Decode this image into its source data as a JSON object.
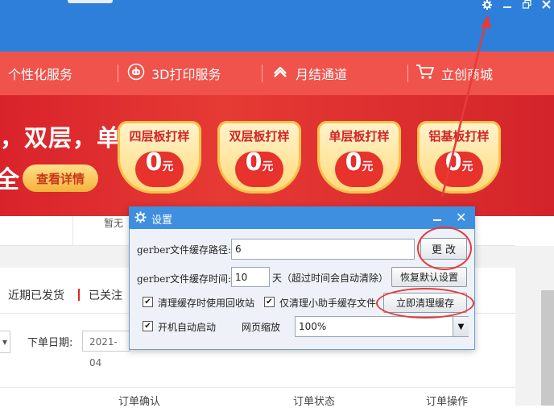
{
  "window": {
    "icons": [
      "gear-icon",
      "minimize-icon",
      "maximize-icon",
      "close-icon"
    ]
  },
  "nav": {
    "items": [
      {
        "label": "个性化服务",
        "icon": ""
      },
      {
        "label": "3D打印服务",
        "icon": "robot-icon"
      },
      {
        "label": "月结通道",
        "icon": "link-icon"
      },
      {
        "label": "立创商城",
        "icon": "cart-icon"
      }
    ]
  },
  "banner": {
    "headline": "，双层，单层",
    "headline2": "全",
    "detail_button": "查看详情",
    "promos": [
      {
        "title": "四层板打样",
        "value": "0",
        "unit": "元"
      },
      {
        "title": "双层板打样",
        "value": "0",
        "unit": "元"
      },
      {
        "title": "单层板打样",
        "value": "0",
        "unit": "元"
      },
      {
        "title": "铝基板打样",
        "value": "0",
        "unit": "元"
      }
    ]
  },
  "page": {
    "strip_label": "暂无",
    "tabs": [
      "近期已发货",
      "已关注"
    ],
    "date_label": "下单日期:",
    "date_value": "2021-04",
    "columns": [
      "订单确认",
      "订单状态",
      "订单操作"
    ]
  },
  "dialog": {
    "title": "设置",
    "cache_path_label": "gerber文件缓存路径:",
    "cache_path_value": "6",
    "change_button": "更 改",
    "cache_time_label": "gerber文件缓存时间:",
    "cache_time_value": "10",
    "cache_time_suffix": "天（超过时间会自动清除）",
    "restore_button": "恢复默认设置",
    "use_recycle_label": "清理缓存时使用回收站",
    "use_recycle_checked": true,
    "assistant_only_label": "仅清理小助手缓存文件",
    "assistant_only_checked": true,
    "clear_now_button": "立即清理缓存",
    "autostart_label": "开机自动启动",
    "autostart_checked": true,
    "zoom_label": "网页缩放",
    "zoom_value": "100%"
  },
  "colors": {
    "titlebar": "#2e7fd9",
    "navbar": "#f0534b",
    "banner": "#d9232b",
    "annotation": "#e53b3b",
    "dialog_title": "#3f8fe0"
  }
}
